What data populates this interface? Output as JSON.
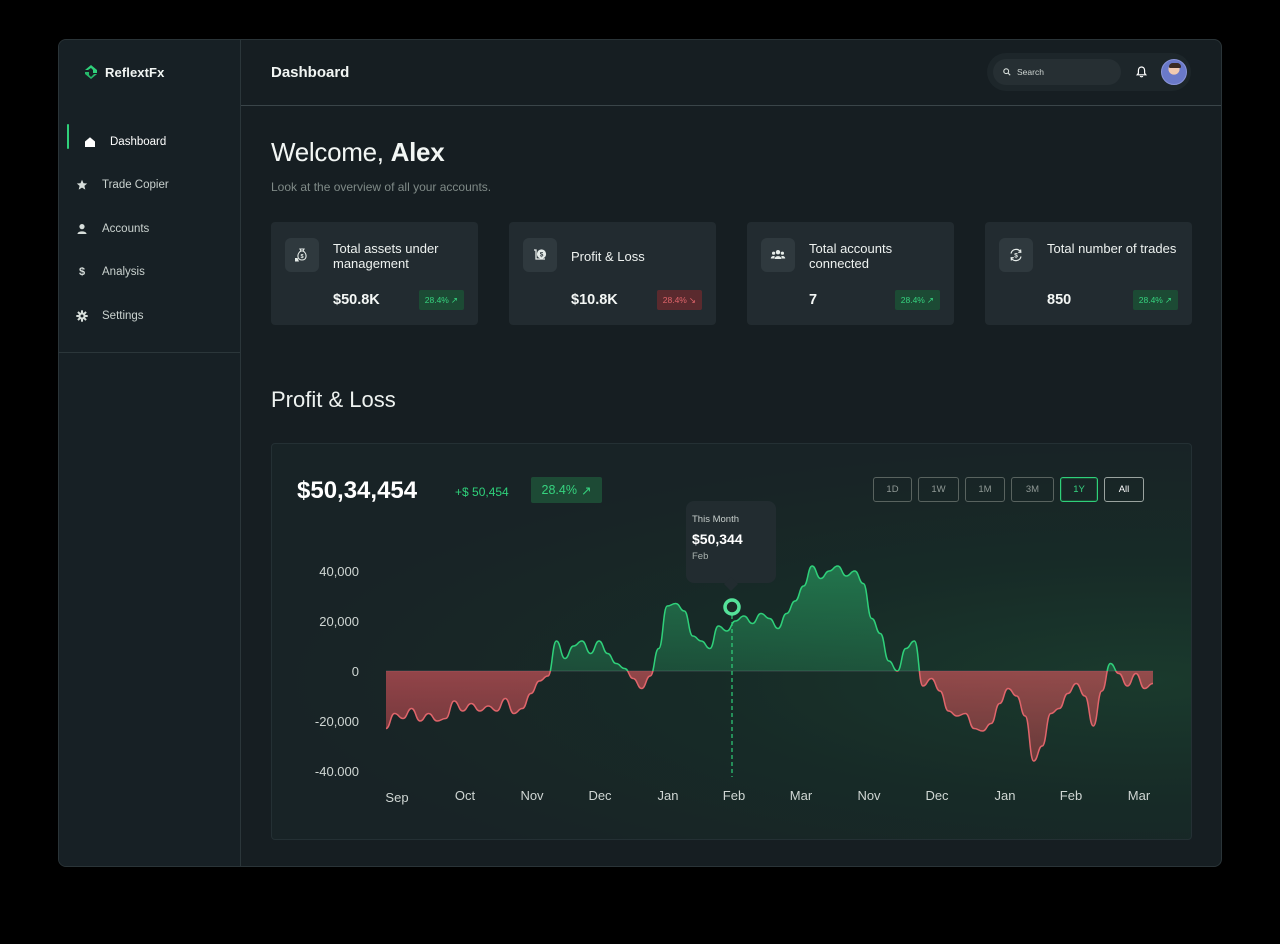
{
  "brand": {
    "name": "ReflextFx"
  },
  "sidebar": {
    "items": [
      {
        "label": "Dashboard",
        "icon": "home-icon",
        "active": true
      },
      {
        "label": "Trade Copier",
        "icon": "star-icon",
        "active": false
      },
      {
        "label": "Accounts",
        "icon": "user-icon",
        "active": false
      },
      {
        "label": "Analysis",
        "icon": "dollar-icon",
        "active": false
      },
      {
        "label": "Settings",
        "icon": "gear-icon",
        "active": false
      }
    ]
  },
  "header": {
    "title": "Dashboard",
    "search_placeholder": "Search"
  },
  "welcome": {
    "greeting": "Welcome,",
    "name": "Alex",
    "subtitle": "Look at the overview of all your accounts."
  },
  "cards": [
    {
      "label": "Total assets under management",
      "value": "$50.8K",
      "change": "28.4%",
      "direction": "up",
      "icon": "money-bag-icon"
    },
    {
      "label": "Profit & Loss",
      "value": "$10.8K",
      "change": "28.4%",
      "direction": "down",
      "icon": "coins-icon"
    },
    {
      "label": "Total accounts connected",
      "value": "7",
      "change": "28.4%",
      "direction": "up",
      "icon": "users-icon"
    },
    {
      "label": "Total number of trades",
      "value": "850",
      "change": "28.4%",
      "direction": "up",
      "icon": "exchange-icon"
    }
  ],
  "pnl": {
    "section_title": "Profit & Loss",
    "total": "$50,34,454",
    "delta": "+$ 50,454",
    "change": "28.4%",
    "ranges": [
      "1D",
      "1W",
      "1M",
      "3M",
      "1Y",
      "All"
    ],
    "active_range": "1Y",
    "tooltip": {
      "label": "This Month",
      "value": "$50,344",
      "month": "Feb"
    }
  },
  "colors": {
    "accent": "#2fd07a",
    "negative": "#e0656b",
    "background": "#161e22"
  },
  "chart_data": {
    "type": "area",
    "x": [
      "Sep",
      "Oct",
      "Nov",
      "Dec",
      "Jan",
      "Feb",
      "Mar",
      "Nov",
      "Dec",
      "Jan",
      "Feb",
      "Mar"
    ],
    "y_ticks": [
      "40,000",
      "20,000",
      "0",
      "-20,000",
      "-40.000"
    ],
    "ylim": [
      -40000,
      40000
    ],
    "highlight": {
      "x": "Feb",
      "value": 50344
    },
    "series": [
      {
        "values": [
          [
            0.0,
            -23000
          ],
          [
            0.1,
            -17000
          ],
          [
            0.2,
            -19000
          ],
          [
            0.3,
            -15000
          ],
          [
            0.4,
            -20000
          ],
          [
            0.5,
            -17000
          ],
          [
            0.6,
            -20000
          ],
          [
            0.7,
            -19000
          ],
          [
            0.8,
            -12000
          ],
          [
            0.9,
            -16000
          ],
          [
            1.0,
            -13000
          ],
          [
            1.1,
            -16000
          ],
          [
            1.2,
            -14000
          ],
          [
            1.3,
            -16000
          ],
          [
            1.4,
            -11000
          ],
          [
            1.5,
            -17000
          ],
          [
            1.6,
            -15000
          ],
          [
            1.7,
            -9000
          ],
          [
            1.8,
            -4000
          ],
          [
            1.9,
            -2000
          ],
          [
            2.0,
            12000
          ],
          [
            2.1,
            5000
          ],
          [
            2.2,
            10000
          ],
          [
            2.3,
            12000
          ],
          [
            2.4,
            7000
          ],
          [
            2.5,
            12000
          ],
          [
            2.6,
            7000
          ],
          [
            2.7,
            3000
          ],
          [
            2.8,
            1000
          ],
          [
            2.9,
            -3000
          ],
          [
            3.0,
            -7000
          ],
          [
            3.1,
            -2000
          ],
          [
            3.2,
            9000
          ],
          [
            3.3,
            26000
          ],
          [
            3.4,
            27000
          ],
          [
            3.5,
            24000
          ],
          [
            3.6,
            14000
          ],
          [
            3.7,
            12000
          ],
          [
            3.8,
            9000
          ],
          [
            3.9,
            18000
          ],
          [
            4.0,
            16000
          ],
          [
            4.1,
            20000
          ],
          [
            4.2,
            22000
          ],
          [
            4.3,
            19000
          ],
          [
            4.4,
            23000
          ],
          [
            4.5,
            21000
          ],
          [
            4.6,
            17000
          ],
          [
            4.7,
            23000
          ],
          [
            4.8,
            28000
          ],
          [
            4.9,
            34000
          ],
          [
            5.0,
            42000
          ],
          [
            5.1,
            37000
          ],
          [
            5.2,
            40000
          ],
          [
            5.3,
            42000
          ],
          [
            5.4,
            38000
          ],
          [
            5.5,
            40000
          ],
          [
            5.6,
            35000
          ],
          [
            5.7,
            21000
          ],
          [
            5.8,
            15000
          ],
          [
            5.9,
            4000
          ],
          [
            6.0,
            0
          ],
          [
            6.1,
            9000
          ],
          [
            6.2,
            12000
          ],
          [
            6.3,
            -6000
          ],
          [
            6.4,
            -3000
          ],
          [
            6.5,
            -8000
          ],
          [
            6.6,
            -16000
          ],
          [
            6.7,
            -18000
          ],
          [
            6.8,
            -17000
          ],
          [
            6.9,
            -23000
          ],
          [
            7.0,
            -24000
          ],
          [
            7.1,
            -21000
          ],
          [
            7.2,
            -13000
          ],
          [
            7.3,
            -7000
          ],
          [
            7.4,
            -10000
          ],
          [
            7.5,
            -18000
          ],
          [
            7.6,
            -36000
          ],
          [
            7.7,
            -30000
          ],
          [
            7.8,
            -17000
          ],
          [
            7.9,
            -15000
          ],
          [
            8.0,
            -9000
          ],
          [
            8.1,
            -5000
          ],
          [
            8.2,
            -10000
          ],
          [
            8.3,
            -22000
          ],
          [
            8.4,
            -8000
          ],
          [
            8.5,
            3000
          ],
          [
            8.6,
            -1000
          ],
          [
            8.7,
            -6000
          ],
          [
            8.8,
            -1000
          ],
          [
            8.9,
            -7000
          ],
          [
            9.0,
            -5000
          ]
        ]
      }
    ]
  }
}
